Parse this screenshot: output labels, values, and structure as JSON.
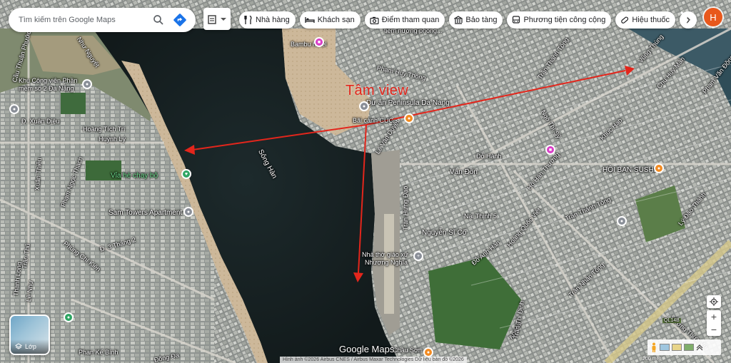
{
  "search": {
    "placeholder": "Tìm kiếm trên Google Maps"
  },
  "chips": [
    {
      "icon": "fork-knife-icon",
      "label": "Nhà hàng"
    },
    {
      "icon": "bed-icon",
      "label": "Khách sạn"
    },
    {
      "icon": "camera-icon",
      "label": "Điểm tham quan"
    },
    {
      "icon": "museum-icon",
      "label": "Bảo tàng"
    },
    {
      "icon": "bus-icon",
      "label": "Phương tiện công cộng"
    },
    {
      "icon": "pill-icon",
      "label": "Hiệu thuốc"
    }
  ],
  "user": {
    "initial": "H"
  },
  "annotation": {
    "text": "Tâm view"
  },
  "map_labels": {
    "river": "Sông Hàn",
    "cau_thuan_phuoc": "Cầu Thuận Phước",
    "nhu_nguyet": "Như Nguyệt",
    "khu_cong_vien": "Khu Công viên Phần",
    "mem_so2": "mềm số 2 Đà Nẵng",
    "xuan_dieu": "Đ. Xuân Diệu",
    "hoang_tich_tri": "Hoàng Tích Trí",
    "huynh_ly": "Huỳnh Lý",
    "via_he": "Vỉa hè chạy bộ",
    "sam_towers": "Sam Towers Apartment",
    "xuan_thieu": "Xuân Thiều",
    "phung_chi_kien": "Phùng Chí Kiên",
    "phan_ngoc_thach": "Phạm Ngọc Thạch",
    "ba_thang_hai": "Đ. 3 Tháng 2",
    "thanh_long": "Thanh Long",
    "tran_thu": "Trần Thủ",
    "nguyen_cau": "Nguyễn Cấu",
    "le_nhu": "Lê Như",
    "dong_da": "Đống Đa",
    "phan_ke_binh": "Phan Kế Bính",
    "bambu_hotel": "Bambu hotel",
    "tiem": "tiệm nướng phòng...",
    "pham_huy_thong": "Phạm Huy Thông",
    "peninsula": "Dự án Peninsula Da Nang",
    "ban_canh": "Bãi cảnh CUC",
    "le_van_duyet": "Lê Văn Duyệt",
    "van_don": "Vân Đồn",
    "do_hanh": "Đỗ Hành",
    "nai_thinh_5": "Nại Thịnh 5",
    "nguyen_si_co": "Nguyễn Sĩ Cố",
    "tran_hung_dao": "Trần Hưng Đạo",
    "nha_tho": "Nhà thờ giáo xứ",
    "nhuong_nghia": "Nhượng Nghĩa",
    "chau_son": "Châu Sơn",
    "hoi_ban_sushi": "HỘI BẠN SUSHI",
    "tran_thanh_tong": "Trần Thánh Tông",
    "ngo_thi_sy": "Ngô Thì Sỹ",
    "hoang_quoc_viet": "Hoàng Quốc Việt",
    "do_anh_han": "Đỗ Anh Hàn",
    "tran_nhan_tong": "Trần Nhân Tông",
    "vuong_thua_vu": "Vương Thừa Vũ",
    "vung_thung": "Vũng Thùng",
    "chu_huy_man": "Chu Huy Mân",
    "pham_van_dong": "Phạm Văn Đồng",
    "ly_thanh": "Lý Đạo Thành",
    "an_hai": "An Hải",
    "khuc_hao": "Khúc Hạo",
    "ho_han_thuong": "Hồ Hán Thương",
    "ql14b": "QL14B",
    "tran_thi_dinh": "Trần Thị Định"
  },
  "layers": {
    "label": "Lớp"
  },
  "brand": "Google Maps",
  "attribution": "Hình ảnh ©2026 Airbus CNES / Airbus Maxar Technologies Dữ liệu bản đồ ©2026",
  "scale": "200 mét",
  "colors": {
    "arrow": "#e3261c",
    "pin_red": "#e53935",
    "pin_gray": "#8a8f98",
    "pin_pink": "#d93ec7",
    "pin_orange": "#f28b22",
    "pin_green": "#2ea563"
  }
}
